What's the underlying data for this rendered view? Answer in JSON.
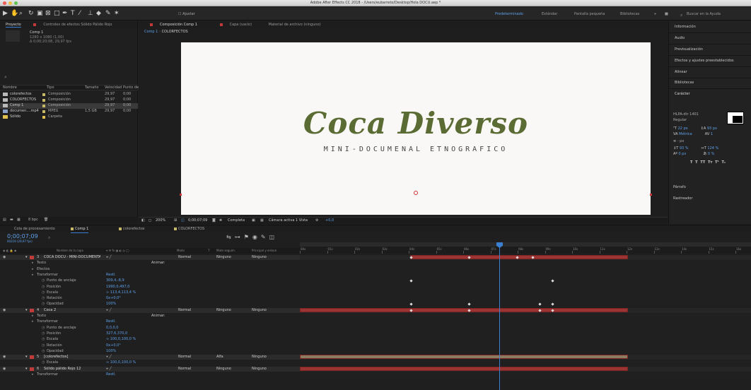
{
  "window": {
    "title": "Adobe After Effects CC 2018 - /Users/eubarreto/Desktop/Hola DOCU.aep *"
  },
  "toolbar": {
    "snap_label": "Ajustar",
    "workspaces": [
      "Predeterminado",
      "Estándar",
      "Pantalla pequeña",
      "Bibliotecas"
    ],
    "search_placeholder": "Buscar en la Ayuda"
  },
  "project": {
    "tab_label": "Proyecto",
    "effects_tab": "Controles de efectos Sólido Pálido Rojo",
    "selected": {
      "name": "Comp 1",
      "line1": "1280 x 1080 (1,00)",
      "line2": "Δ 0;00;20;08, 29,97 fps"
    },
    "columns": [
      "Nombre",
      "Tipo",
      "Tamaño",
      "Velocidad",
      "Punto de"
    ],
    "items": [
      {
        "name": "colorefectos",
        "color": "#b9b9b9",
        "type": "Composición",
        "size": "",
        "fps": "29,97",
        "dur": "0;00"
      },
      {
        "name": "COLORFECTOS",
        "color": "#b9b9b9",
        "type": "Composición",
        "size": "",
        "fps": "29,97",
        "dur": "0;00"
      },
      {
        "name": "Comp 1",
        "color": "#b9b9b9",
        "type": "Composición",
        "size": "",
        "fps": "29,97",
        "dur": "0;00"
      },
      {
        "name": "documen....mp4",
        "color": "#8aa0c8",
        "type": "MPEG",
        "size": "1,5 GB",
        "fps": "29,97",
        "dur": "0;00"
      },
      {
        "name": "Sólido",
        "color": "#e0c050",
        "type": "Carpeta",
        "size": "",
        "fps": "",
        "dur": ""
      }
    ],
    "bpc": "8 bpc"
  },
  "comp": {
    "tabs": [
      "Composición Comp 1",
      "Capa (vacío)",
      "Material de archivo (ninguno)"
    ],
    "breadcrumb": [
      "Comp 1",
      "COLORFECTOS"
    ],
    "title": "Coca Diverso",
    "subtitle": "MINI-DOCUMENAL ETNOGRAFICO",
    "zoom": "200%",
    "timecode": "0;00;07;09",
    "resolution": "Completa",
    "camera": "Cámara activa",
    "views": "1 Vista",
    "offset": "+0,0"
  },
  "right": {
    "panels": [
      "Información",
      "Audio",
      "Previsualización",
      "Efectos y ajustes preestablecidos",
      "Alinear",
      "Bibliotecas",
      "Carácter"
    ],
    "font": "HLPA-dtr 1401",
    "font_style": "Regular",
    "size": "22 px",
    "leading": "93 px",
    "kerning": "Métrica",
    "tracking": "1",
    "stroke": "- px",
    "vscale": "93 %",
    "hscale": "124 %",
    "baseline": "0 px",
    "tsume": "0 %",
    "format_buttons": [
      "T",
      "T",
      "TT",
      "Tт",
      "T¹",
      "T₁"
    ],
    "bottom": [
      "Párrafo",
      "Rastreador"
    ]
  },
  "timeline": {
    "tabs": [
      "Cola de procesamiento",
      "Comp 1",
      "colorefectos",
      "COLORFECTOS"
    ],
    "timecode": "0;00;07;09",
    "fps_label": "00219 (29,97 fps)",
    "header": [
      "Nombre de la capa",
      "Modo",
      "T",
      "Mate seguim.",
      "Principal y enlace"
    ],
    "ruler": [
      "00s",
      "01s",
      "02s",
      "03s",
      "04s",
      "05s",
      "06s",
      "07s",
      "08s",
      "09s",
      "10s",
      "11s",
      "12s",
      "13s",
      "14s",
      "15s",
      "16s"
    ],
    "animate": "Animar:",
    "rows": [
      {
        "kind": "layer",
        "num": "3",
        "name": "COCA DOCU - MINI-DOCUMENTAL ETNOGRAFICO",
        "mode": "Normal",
        "track": "Ninguno",
        "parent": "Ninguno"
      },
      {
        "kind": "prop",
        "name": "Texto",
        "val": ""
      },
      {
        "kind": "prop",
        "name": "Efectos",
        "val": ""
      },
      {
        "kind": "prop",
        "name": "Transformar",
        "val": "Restl."
      },
      {
        "kind": "prop",
        "name": "Punto de anclaje",
        "val": "309,4,-8,9"
      },
      {
        "kind": "prop",
        "name": "Posición",
        "val": "1990,0,497,0"
      },
      {
        "kind": "prop",
        "name": "Escala",
        "val": "∞ 113,4,113,4 %"
      },
      {
        "kind": "prop",
        "name": "Rotación",
        "val": "0x+0,0°"
      },
      {
        "kind": "prop",
        "name": "Opacidad",
        "val": "100%"
      },
      {
        "kind": "layer",
        "num": "4",
        "name": "Coca 2",
        "mode": "Normal",
        "track": "Ninguno",
        "parent": "Ninguno"
      },
      {
        "kind": "prop",
        "name": "Texto",
        "val": ""
      },
      {
        "kind": "prop",
        "name": "Transformar",
        "val": "Restl."
      },
      {
        "kind": "prop",
        "name": "Punto de anclaje",
        "val": "0,0,0,0"
      },
      {
        "kind": "prop",
        "name": "Posición",
        "val": "327,6,370,0"
      },
      {
        "kind": "prop",
        "name": "Escala",
        "val": "∞ 100,0,100,0 %"
      },
      {
        "kind": "prop",
        "name": "Rotación",
        "val": "0x+0,0°"
      },
      {
        "kind": "prop",
        "name": "Opacidad",
        "val": "100%"
      },
      {
        "kind": "layer",
        "num": "5",
        "name": "[colorefectos]",
        "mode": "Normal",
        "track": "Alfa",
        "parent": "Ninguno"
      },
      {
        "kind": "prop",
        "name": "Escala",
        "val": "∞ 100,0,100,0 %"
      },
      {
        "kind": "layer",
        "num": "6",
        "name": "Sólido pálido Rojo 12",
        "mode": "Normal",
        "track": "Ninguno",
        "parent": "Ninguno"
      },
      {
        "kind": "prop",
        "name": "Transformar",
        "val": "Restl."
      }
    ]
  },
  "colors": {
    "accent": "#5ea0ea",
    "playhead": "#3b7fd1",
    "title_green": "#5b6b34",
    "bar_red": "#9c3433",
    "bar_tan": "#8b7b61"
  }
}
